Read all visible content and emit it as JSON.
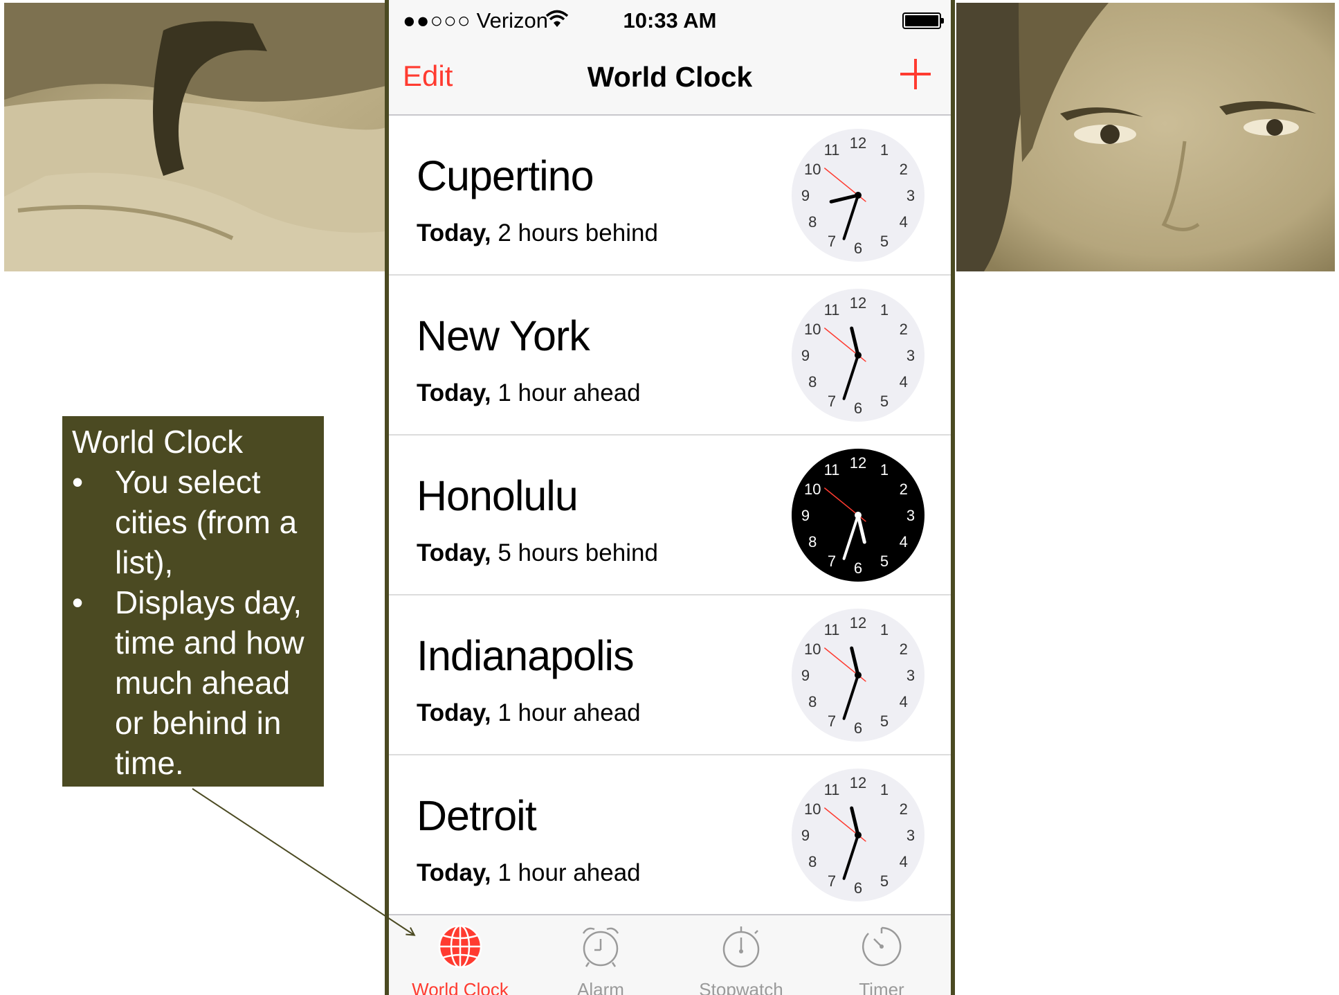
{
  "status_bar": {
    "signal": "●●○○○",
    "carrier": "Verizon",
    "time": "10:33 AM"
  },
  "nav": {
    "edit_label": "Edit",
    "title": "World Clock",
    "add_icon": "plus-icon"
  },
  "cities": [
    {
      "name": "Cupertino",
      "day": "Today,",
      "offset": "2 hours behind",
      "clock_time": "8:33",
      "dark_face": false
    },
    {
      "name": "New York",
      "day": "Today,",
      "offset": "1 hour ahead",
      "clock_time": "11:33",
      "dark_face": false
    },
    {
      "name": "Honolulu",
      "day": "Today,",
      "offset": "5 hours behind",
      "clock_time": "5:33",
      "dark_face": true
    },
    {
      "name": "Indianapolis",
      "day": "Today,",
      "offset": "1 hour ahead",
      "clock_time": "11:33",
      "dark_face": false
    },
    {
      "name": "Detroit",
      "day": "Today,",
      "offset": "1 hour ahead",
      "clock_time": "11:33",
      "dark_face": false
    }
  ],
  "tabs": [
    {
      "label": "World Clock",
      "icon": "globe-icon",
      "active": true
    },
    {
      "label": "Alarm",
      "icon": "alarm-clock-icon",
      "active": false
    },
    {
      "label": "Stopwatch",
      "icon": "stopwatch-icon",
      "active": false
    },
    {
      "label": "Timer",
      "icon": "timer-icon",
      "active": false
    }
  ],
  "callout": {
    "heading": "World Clock",
    "bullet_char": "•",
    "bullets": [
      "You select cities (from a list),",
      "Displays day, time and how much ahead or behind in time."
    ]
  },
  "colors": {
    "accent": "#ff3b30",
    "callout_bg": "#4b4a22",
    "photo_tint": "#b9a97f"
  }
}
